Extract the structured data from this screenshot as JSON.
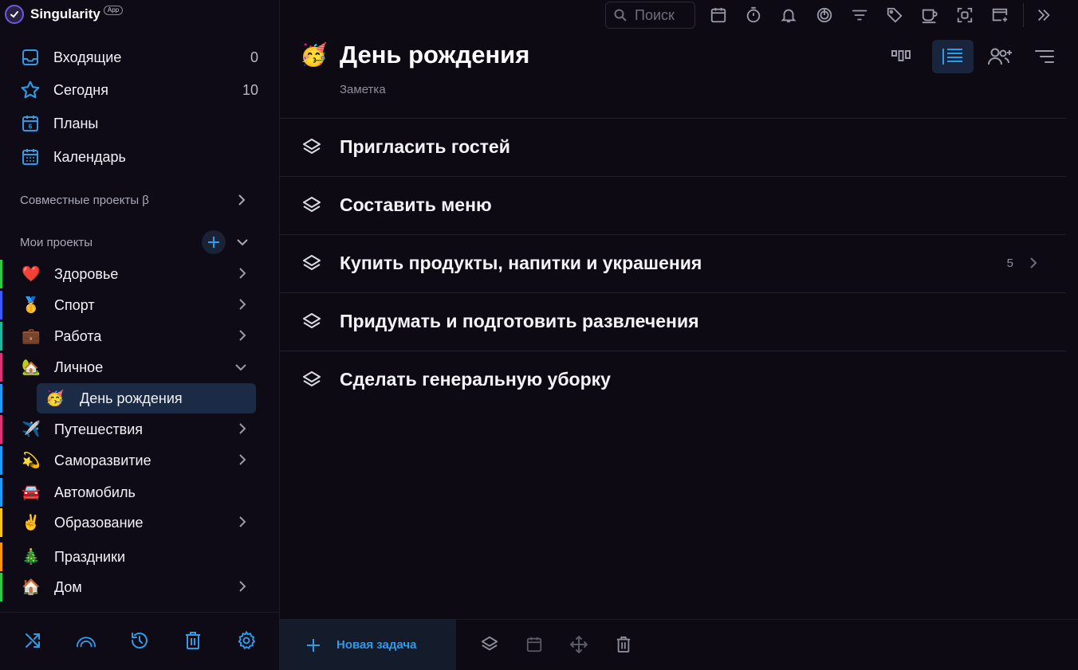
{
  "app": {
    "name": "Singularity",
    "tag": "App"
  },
  "sidebar": {
    "nav": [
      {
        "label": "Входящие",
        "count": "0",
        "icon": "inbox-icon"
      },
      {
        "label": "Сегодня",
        "count": "10",
        "icon": "star-icon"
      },
      {
        "label": "Планы",
        "count": "",
        "icon": "calendar-day-icon"
      },
      {
        "label": "Календарь",
        "count": "",
        "icon": "calendar-icon"
      }
    ],
    "shared_projects": "Совместные проекты β",
    "my_projects": "Мои проекты",
    "projects": [
      {
        "emoji": "❤️",
        "name": "Здоровье",
        "color": "#2ecc40",
        "chevron": "right"
      },
      {
        "emoji": "🥇",
        "name": "Спорт",
        "color": "#3d5afe",
        "chevron": "right"
      },
      {
        "emoji": "💼",
        "name": "Работа",
        "color": "#1fb5a0",
        "chevron": "right"
      },
      {
        "emoji": "🏡",
        "name": "Личное",
        "color": "#e0317a",
        "chevron": "down"
      },
      {
        "emoji": "🥳",
        "name": "День рождения",
        "color": "#1e9bff",
        "chevron": ""
      },
      {
        "emoji": "✈️",
        "name": "Путешествия",
        "color": "#e0317a",
        "chevron": "right"
      },
      {
        "emoji": "💫",
        "name": "Саморазвитие",
        "color": "#1e9bff",
        "chevron": "right"
      },
      {
        "emoji": "🚘",
        "name": "Автомобиль",
        "color": "#1e9bff",
        "chevron": ""
      },
      {
        "emoji": "✌️",
        "name": "Образование",
        "color": "#f5c518",
        "chevron": "right"
      },
      {
        "emoji": "🎄",
        "name": "Праздники",
        "color": "#ff9800",
        "chevron": ""
      },
      {
        "emoji": "🏠",
        "name": "Дом",
        "color": "#2ecc40",
        "chevron": "right"
      }
    ]
  },
  "toolbar": {
    "search_placeholder": "Поиск"
  },
  "main": {
    "emoji": "🥳",
    "title": "День рождения",
    "subtitle": "Заметка",
    "tasks": [
      {
        "label": "Пригласить гостей",
        "count": ""
      },
      {
        "label": "Составить меню",
        "count": ""
      },
      {
        "label": "Купить продукты, напитки и украшения",
        "count": "5"
      },
      {
        "label": "Придумать и подготовить развлечения",
        "count": ""
      },
      {
        "label": "Сделать генеральную уборку",
        "count": ""
      }
    ],
    "new_task": "Новая задача"
  },
  "colors": {
    "accent": "#2d9be8",
    "background": "#0d0a14"
  }
}
